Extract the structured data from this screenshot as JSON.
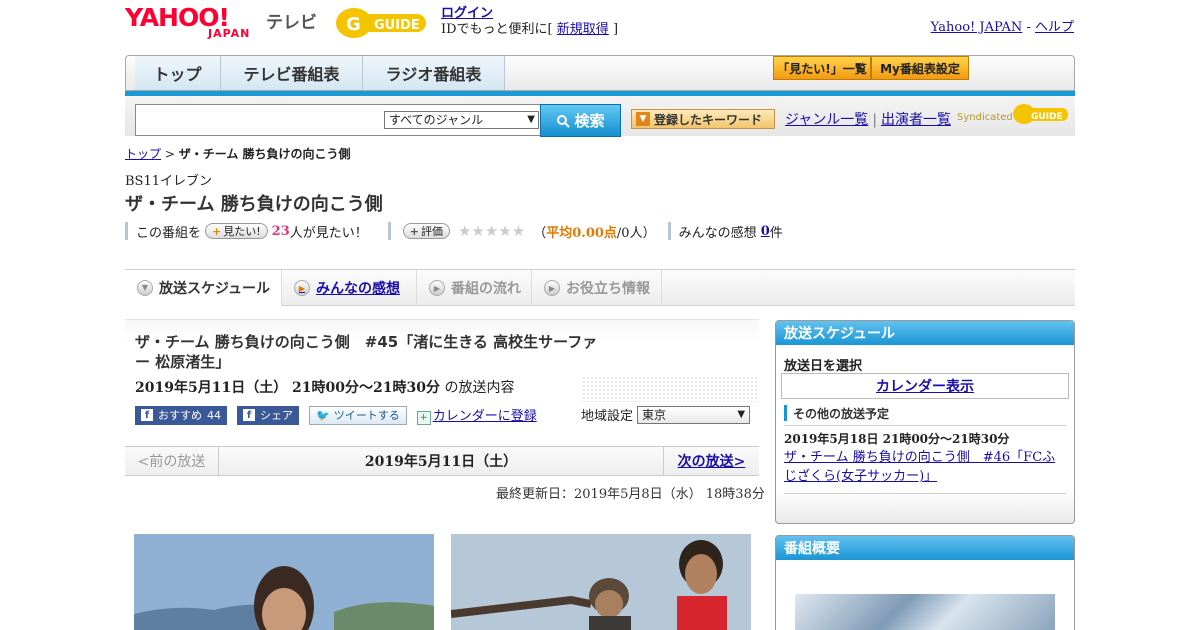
{
  "header": {
    "logo_yahoo": "YAHOO!",
    "logo_japan": "JAPAN",
    "logo_tv": "テレビ",
    "gguide_logo": "G GUIDE",
    "login": "ログイン",
    "login_prefix": "IDでもっと便利に[",
    "signup": "新規取得",
    "login_suffix": "]",
    "yahoo_japan_link": "Yahoo! JAPAN",
    "help_sep": "-",
    "help_link": "ヘルプ"
  },
  "nav": {
    "tabs": [
      "トップ",
      "テレビ番組表",
      "ラジオ番組表"
    ],
    "want_list": "「見たい!」一覧",
    "my_schedule": "My番組表設定"
  },
  "search": {
    "genre_value": "すべてのジャンル",
    "button": "検索",
    "keyword_button": "登録したキーワード",
    "genre_list": "ジャンル一覧",
    "link_sep": "|",
    "cast_list": "出演者一覧",
    "syndicated": "Syndicated"
  },
  "breadcrumb": {
    "top": "トップ",
    "sep": ">",
    "current": "ザ・チーム 勝ち負けの向こう側"
  },
  "program": {
    "station": "BS11イレブン",
    "title": "ザ・チーム 勝ち負けの向こう側",
    "want_prefix": "この番組を",
    "want_button": "見たい!",
    "want_count": "23",
    "want_suffix": "人が見たい！",
    "rate_button": "評価",
    "stars": "★★★★★",
    "avg_open": "（",
    "avg_label": "平均0.00点",
    "avg_rest": "/0人）",
    "impressions_label": "みんなの感想",
    "impressions_count": "0",
    "impressions_unit": "件"
  },
  "subtabs": [
    {
      "label": "放送スケジュール"
    },
    {
      "label": "みんなの感想"
    },
    {
      "label": "番組の流れ"
    },
    {
      "label": "お役立ち情報"
    }
  ],
  "episode": {
    "title": "ザ・チーム 勝ち負けの向こう側　#45「渚に生きる 高校生サーファー 松原渚生」",
    "date": "2019年5月11日（土） 21時00分～21時30分",
    "date_suffix": "の放送内容",
    "fb_recommend": "おすすめ",
    "fb_count": "44",
    "fb_share": "シェア",
    "tweet": "ツイートする",
    "calendar": "カレンダーに登録",
    "region_label": "地域設定",
    "region_value": "東京",
    "prev": "<前の放送",
    "current_date": "2019年5月11日（土）",
    "next": "次の放送>",
    "updated": "最終更新日：2019年5月8日（水） 18時38分"
  },
  "sidebar": {
    "schedule_head": "放送スケジュール",
    "select_date": "放送日を選択",
    "calendar_view": "カレンダー表示",
    "other_head": "その他の放送予定",
    "other_date": "2019年5月18日 21時00分～21時30分",
    "other_link": "ザ・チーム 勝ち負けの向こう側　#46「FCふじざくら(女子サッカー)」",
    "summary_head": "番組概要"
  },
  "colors": {
    "brand_red": "#ff0033",
    "accent_blue": "#1a95d4",
    "link": "#1a0dab",
    "orange": "#e57800"
  }
}
